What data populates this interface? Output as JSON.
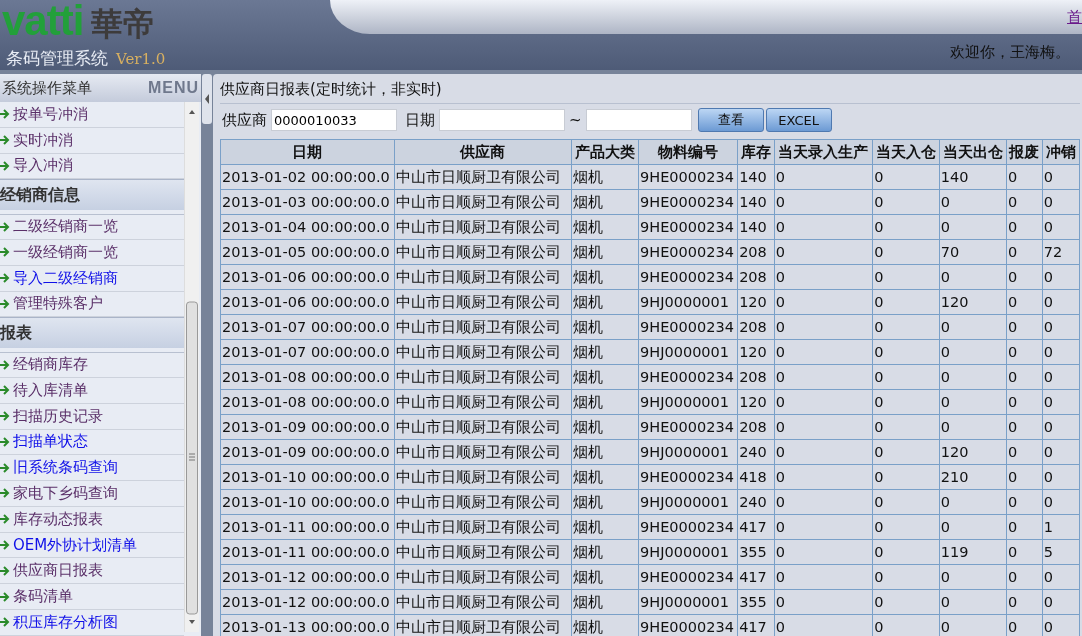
{
  "header": {
    "logo": "vatti",
    "logo_cn": "華帝",
    "system_name": "条码管理系统",
    "version": "Ver1.0",
    "home_link": "首",
    "welcome": "欢迎你，王海梅。"
  },
  "sidebar": {
    "title": "系统操作菜单",
    "title_en": "MENU",
    "sections": [
      {
        "items": [
          {
            "label": "按单号冲消",
            "visited": true
          },
          {
            "label": "实时冲消",
            "visited": true
          },
          {
            "label": "导入冲消",
            "visited": true
          }
        ]
      },
      {
        "heading": "经销商信息",
        "items": [
          {
            "label": "二级经销商一览",
            "visited": true
          },
          {
            "label": "一级经销商一览",
            "visited": true
          },
          {
            "label": "导入二级经销商",
            "visited": false
          },
          {
            "label": "管理特殊客户",
            "visited": true
          }
        ]
      },
      {
        "heading": "报表",
        "items": [
          {
            "label": "经销商库存",
            "visited": true
          },
          {
            "label": "待入库清单",
            "visited": true
          },
          {
            "label": "扫描历史记录",
            "visited": true
          },
          {
            "label": "扫描单状态",
            "visited": false
          },
          {
            "label": "旧系统条码查询",
            "visited": false
          },
          {
            "label": "家电下乡码查询",
            "visited": true
          },
          {
            "label": "库存动态报表",
            "visited": true
          },
          {
            "label": "OEM外协计划清单",
            "visited": false
          },
          {
            "label": "供应商日报表",
            "visited": true
          },
          {
            "label": "条码清单",
            "visited": true
          },
          {
            "label": "积压库存分析图",
            "visited": false
          }
        ]
      }
    ]
  },
  "report": {
    "title": "供应商日报表(定时统计，非实时)",
    "filters": {
      "supplier_label": "供应商",
      "supplier_value": "0000010033",
      "date_label": "日期",
      "range_sep": "~",
      "buttons": [
        "查看",
        "EXCEL"
      ]
    },
    "table": {
      "columns": [
        "日期",
        "供应商",
        "产品大类",
        "物料编号",
        "库存",
        "当天录入生产",
        "当天入仓",
        "当天出仓",
        "报废",
        "冲销"
      ],
      "rows": [
        [
          "2013-01-02 00:00:00.0",
          "中山市日顺厨卫有限公司",
          "烟机",
          "9HE0000234",
          "140",
          "0",
          "0",
          "140",
          "0",
          "0"
        ],
        [
          "2013-01-03 00:00:00.0",
          "中山市日顺厨卫有限公司",
          "烟机",
          "9HE0000234",
          "140",
          "0",
          "0",
          "0",
          "0",
          "0"
        ],
        [
          "2013-01-04 00:00:00.0",
          "中山市日顺厨卫有限公司",
          "烟机",
          "9HE0000234",
          "140",
          "0",
          "0",
          "0",
          "0",
          "0"
        ],
        [
          "2013-01-05 00:00:00.0",
          "中山市日顺厨卫有限公司",
          "烟机",
          "9HE0000234",
          "208",
          "0",
          "0",
          "70",
          "0",
          "72"
        ],
        [
          "2013-01-06 00:00:00.0",
          "中山市日顺厨卫有限公司",
          "烟机",
          "9HE0000234",
          "208",
          "0",
          "0",
          "0",
          "0",
          "0"
        ],
        [
          "2013-01-06 00:00:00.0",
          "中山市日顺厨卫有限公司",
          "烟机",
          "9HJ0000001",
          "120",
          "0",
          "0",
          "120",
          "0",
          "0"
        ],
        [
          "2013-01-07 00:00:00.0",
          "中山市日顺厨卫有限公司",
          "烟机",
          "9HE0000234",
          "208",
          "0",
          "0",
          "0",
          "0",
          "0"
        ],
        [
          "2013-01-07 00:00:00.0",
          "中山市日顺厨卫有限公司",
          "烟机",
          "9HJ0000001",
          "120",
          "0",
          "0",
          "0",
          "0",
          "0"
        ],
        [
          "2013-01-08 00:00:00.0",
          "中山市日顺厨卫有限公司",
          "烟机",
          "9HE0000234",
          "208",
          "0",
          "0",
          "0",
          "0",
          "0"
        ],
        [
          "2013-01-08 00:00:00.0",
          "中山市日顺厨卫有限公司",
          "烟机",
          "9HJ0000001",
          "120",
          "0",
          "0",
          "0",
          "0",
          "0"
        ],
        [
          "2013-01-09 00:00:00.0",
          "中山市日顺厨卫有限公司",
          "烟机",
          "9HE0000234",
          "208",
          "0",
          "0",
          "0",
          "0",
          "0"
        ],
        [
          "2013-01-09 00:00:00.0",
          "中山市日顺厨卫有限公司",
          "烟机",
          "9HJ0000001",
          "240",
          "0",
          "0",
          "120",
          "0",
          "0"
        ],
        [
          "2013-01-10 00:00:00.0",
          "中山市日顺厨卫有限公司",
          "烟机",
          "9HE0000234",
          "418",
          "0",
          "0",
          "210",
          "0",
          "0"
        ],
        [
          "2013-01-10 00:00:00.0",
          "中山市日顺厨卫有限公司",
          "烟机",
          "9HJ0000001",
          "240",
          "0",
          "0",
          "0",
          "0",
          "0"
        ],
        [
          "2013-01-11 00:00:00.0",
          "中山市日顺厨卫有限公司",
          "烟机",
          "9HE0000234",
          "417",
          "0",
          "0",
          "0",
          "0",
          "1"
        ],
        [
          "2013-01-11 00:00:00.0",
          "中山市日顺厨卫有限公司",
          "烟机",
          "9HJ0000001",
          "355",
          "0",
          "0",
          "119",
          "0",
          "5"
        ],
        [
          "2013-01-12 00:00:00.0",
          "中山市日顺厨卫有限公司",
          "烟机",
          "9HE0000234",
          "417",
          "0",
          "0",
          "0",
          "0",
          "0"
        ],
        [
          "2013-01-12 00:00:00.0",
          "中山市日顺厨卫有限公司",
          "烟机",
          "9HJ0000001",
          "355",
          "0",
          "0",
          "0",
          "0",
          "0"
        ],
        [
          "2013-01-13 00:00:00.0",
          "中山市日顺厨卫有限公司",
          "烟机",
          "9HE0000234",
          "417",
          "0",
          "0",
          "0",
          "0",
          "0"
        ]
      ]
    }
  }
}
